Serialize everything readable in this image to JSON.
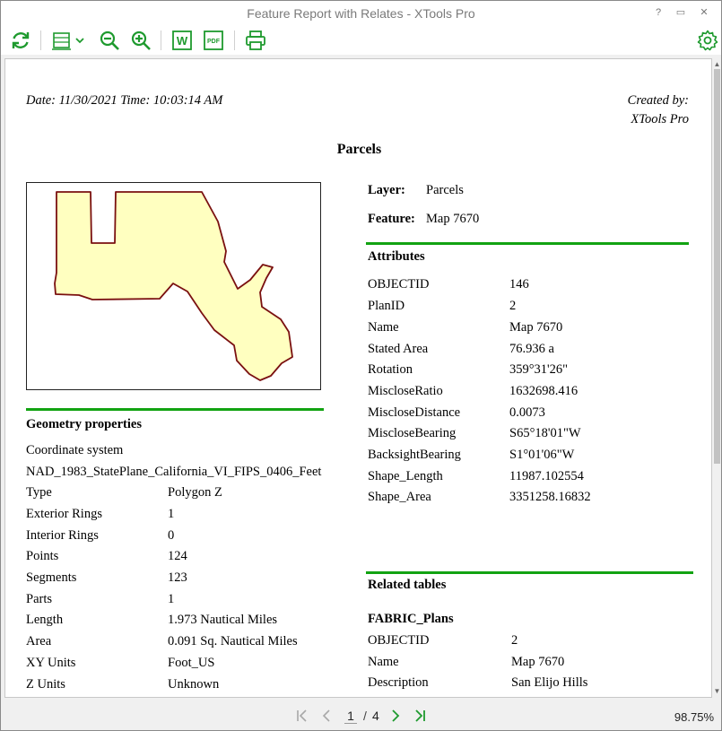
{
  "window": {
    "title": "Feature Report with Relates - XTools Pro",
    "help_glyph": "?",
    "restore_glyph": "▭",
    "close_glyph": "✕"
  },
  "toolbar": {
    "icons": [
      "refresh-icon",
      "fit-page-icon",
      "zoom-out-icon",
      "zoom-in-icon",
      "export-word-icon",
      "export-pdf-icon",
      "print-icon",
      "settings-icon"
    ],
    "word_label": "W",
    "pdf_label": "PDF",
    "accent_color": "#1e9a2e"
  },
  "report": {
    "date_line": "Date: 11/30/2021 Time: 10:03:14 AM",
    "created_by": "Created by:",
    "created_by_app": "XTools Pro",
    "title": "Parcels",
    "layer_label": "Layer:",
    "layer_value": "Parcels",
    "feature_label": "Feature:",
    "feature_value": "Map 7670",
    "attributes_heading": "Attributes",
    "attributes": [
      {
        "name": "OBJECTID",
        "value": "146"
      },
      {
        "name": "PlanID",
        "value": "2"
      },
      {
        "name": "Name",
        "value": "Map 7670"
      },
      {
        "name": "Stated Area",
        "value": "76.936 a"
      },
      {
        "name": "Rotation",
        "value": "359°31'26\""
      },
      {
        "name": "MiscloseRatio",
        "value": "1632698.416"
      },
      {
        "name": "MiscloseDistance",
        "value": "0.0073"
      },
      {
        "name": "MiscloseBearing",
        "value": "S65°18'01\"W"
      },
      {
        "name": "BacksightBearing",
        "value": "S1°01'06\"W"
      },
      {
        "name": "Shape_Length",
        "value": "11987.102554"
      },
      {
        "name": "Shape_Area",
        "value": "3351258.16832"
      }
    ],
    "geometry_heading": "Geometry properties",
    "coordinate_system_label": "Coordinate system",
    "coordinate_system_value": "NAD_1983_StatePlane_California_VI_FIPS_0406_Feet",
    "geometry": [
      {
        "name": "Type",
        "value": "Polygon Z"
      },
      {
        "name": "Exterior Rings",
        "value": "1"
      },
      {
        "name": "Interior Rings",
        "value": "0"
      },
      {
        "name": "Points",
        "value": "124"
      },
      {
        "name": "Segments",
        "value": "123"
      },
      {
        "name": "Parts",
        "value": "1"
      },
      {
        "name": "Length",
        "value": "1.973 Nautical Miles"
      },
      {
        "name": "Area",
        "value": "0.091 Sq. Nautical Miles"
      },
      {
        "name": "XY Units",
        "value": "Foot_US"
      },
      {
        "name": "Z Units",
        "value": "Unknown"
      }
    ],
    "related_heading": "Related tables",
    "related_table_name": "FABRIC_Plans",
    "related_rows": [
      {
        "name": "OBJECTID",
        "value": "2"
      },
      {
        "name": "Name",
        "value": "Map 7670"
      },
      {
        "name": "Description",
        "value": "San Elijo Hills"
      }
    ],
    "map": {
      "parcel_fill": "#ffffc0",
      "parcel_stroke": "#7a1010"
    },
    "rule_color": "#12a312"
  },
  "statusbar": {
    "current_page": "1",
    "page_separator": "/",
    "total_pages": "4",
    "zoom": "98.75%"
  }
}
